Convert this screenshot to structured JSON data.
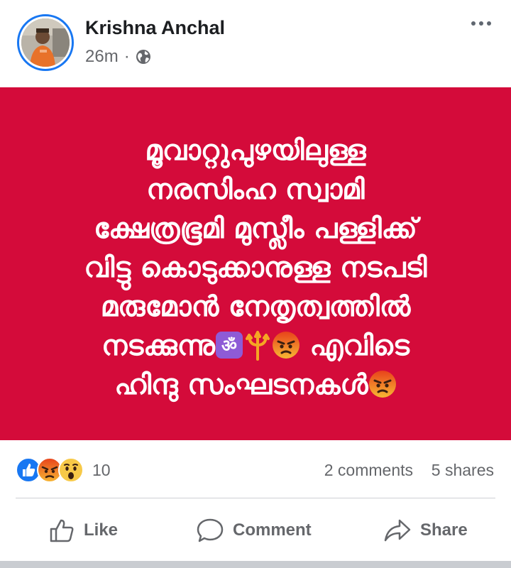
{
  "post": {
    "author": "Krishna Anchal",
    "time": "26m",
    "separator": "·",
    "privacy_icon": "globe-icon",
    "more_icon": "ellipsis-icon"
  },
  "content": {
    "background_color": "#d40b3a",
    "lines": [
      "മൂവാറ്റുപുഴയിലുള്ള",
      "നരസിംഹ സ്വാമി",
      "ക്ഷേത്രഭൂമി മുസ്ലീം പള്ളിക്ക്",
      "വിട്ടു കൊടുക്കാനുള്ള നടപടി",
      "മരുമോൻ  നേതൃത്വത്തിൽ",
      "നടക്കുന്നു",
      "എവിടെ",
      "ഹിന്ദു സംഘടനകൾ"
    ],
    "emojis": [
      "om-emoji",
      "trident-emoji",
      "angry-face-emoji",
      "angry-face-emoji"
    ]
  },
  "stats": {
    "reaction_icons": [
      "like-icon",
      "angry-icon",
      "wow-icon"
    ],
    "reaction_count": "10",
    "comments": "2 comments",
    "shares": "5 shares"
  },
  "actions": {
    "like": "Like",
    "comment": "Comment",
    "share": "Share"
  },
  "colors": {
    "accent": "#1877f2",
    "muted_text": "#65676b",
    "name_text": "#1c1e21"
  }
}
